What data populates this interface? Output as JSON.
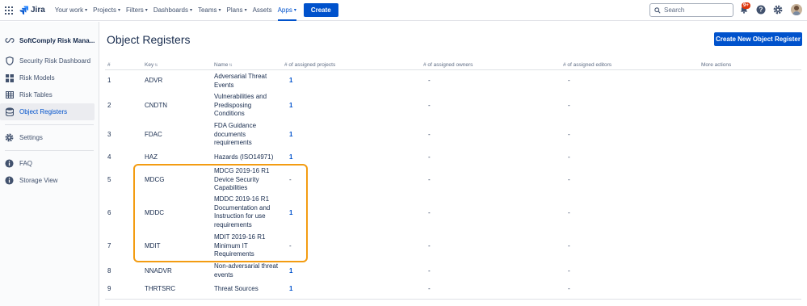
{
  "topnav": {
    "logo_text": "Jira",
    "items": [
      {
        "label": "Your work"
      },
      {
        "label": "Projects"
      },
      {
        "label": "Filters"
      },
      {
        "label": "Dashboards"
      },
      {
        "label": "Teams"
      },
      {
        "label": "Plans"
      },
      {
        "label": "Assets"
      },
      {
        "label": "Apps"
      }
    ],
    "create_label": "Create",
    "search_placeholder": "Search",
    "notification_badge": "9+"
  },
  "sidebar": {
    "project_name": "SoftComply Risk Mana...",
    "items": [
      {
        "label": "Security Risk Dashboard",
        "icon": "shield-icon"
      },
      {
        "label": "Risk Models",
        "icon": "grid-icon"
      },
      {
        "label": "Risk Tables",
        "icon": "table-icon"
      },
      {
        "label": "Object Registers",
        "icon": "database-icon"
      }
    ],
    "settings_label": "Settings",
    "faq_label": "FAQ",
    "storage_label": "Storage View"
  },
  "main": {
    "title": "Object Registers",
    "create_button": "Create New Object Register",
    "columns": {
      "num": "#",
      "key": "Key",
      "name": "Name",
      "projects": "# of assigned projects",
      "owners": "# of assigned owners",
      "editors": "# of assigned editors",
      "actions": "More actions"
    },
    "rows": [
      {
        "num": "1",
        "key": "ADVR",
        "name": "Adversarial Threat Events",
        "projects": "1",
        "owners": "-",
        "editors": "-"
      },
      {
        "num": "2",
        "key": "CNDTN",
        "name": "Vulnerabilities and Predisposing Conditions",
        "projects": "1",
        "owners": "-",
        "editors": "-"
      },
      {
        "num": "3",
        "key": "FDAC",
        "name": "FDA Guidance documents requirements",
        "projects": "1",
        "owners": "-",
        "editors": "-"
      },
      {
        "num": "4",
        "key": "HAZ",
        "name": "Hazards (ISO14971)",
        "projects": "1",
        "owners": "-",
        "editors": "-"
      },
      {
        "num": "5",
        "key": "MDCG",
        "name": "MDCG 2019-16 R1 Device Security Capabilities",
        "projects": "-",
        "owners": "-",
        "editors": "-"
      },
      {
        "num": "6",
        "key": "MDDC",
        "name": "MDDC 2019-16 R1 Documentation and Instruction for use requirements",
        "projects": "1",
        "owners": "-",
        "editors": "-"
      },
      {
        "num": "7",
        "key": "MDIT",
        "name": "MDIT 2019-16 R1 Minimum IT Requirements",
        "projects": "-",
        "owners": "-",
        "editors": "-"
      },
      {
        "num": "8",
        "key": "NNADVR",
        "name": "Non-adversarial threat events",
        "projects": "1",
        "owners": "-",
        "editors": "-"
      },
      {
        "num": "9",
        "key": "THRTSRC",
        "name": "Threat Sources",
        "projects": "1",
        "owners": "-",
        "editors": "-"
      }
    ]
  },
  "colors": {
    "primary": "#0052cc",
    "highlight": "#f39c12",
    "badge": "#de350b"
  }
}
